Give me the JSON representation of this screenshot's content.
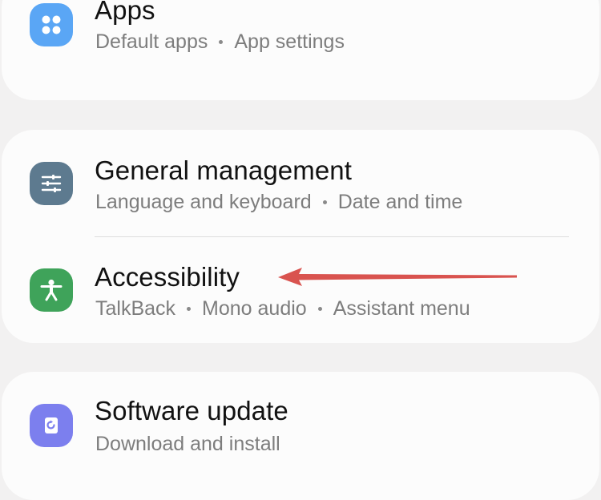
{
  "settings": {
    "apps": {
      "title": "Apps",
      "subtitle": [
        "Default apps",
        "App settings"
      ],
      "icon": "apps-grid-icon",
      "icon_color": "#5aa6f5"
    },
    "general_management": {
      "title": "General management",
      "subtitle": [
        "Language and keyboard",
        "Date and time"
      ],
      "icon": "sliders-icon",
      "icon_color": "#5d7a8f"
    },
    "accessibility": {
      "title": "Accessibility",
      "subtitle": [
        "TalkBack",
        "Mono audio",
        "Assistant menu"
      ],
      "icon": "accessibility-person-icon",
      "icon_color": "#3fa35a"
    },
    "software_update": {
      "title": "Software update",
      "subtitle": [
        "Download and install"
      ],
      "icon": "software-update-icon",
      "icon_color": "#7c7fee"
    }
  },
  "annotation": {
    "arrow_color": "#d9534f",
    "points_to": "accessibility"
  }
}
